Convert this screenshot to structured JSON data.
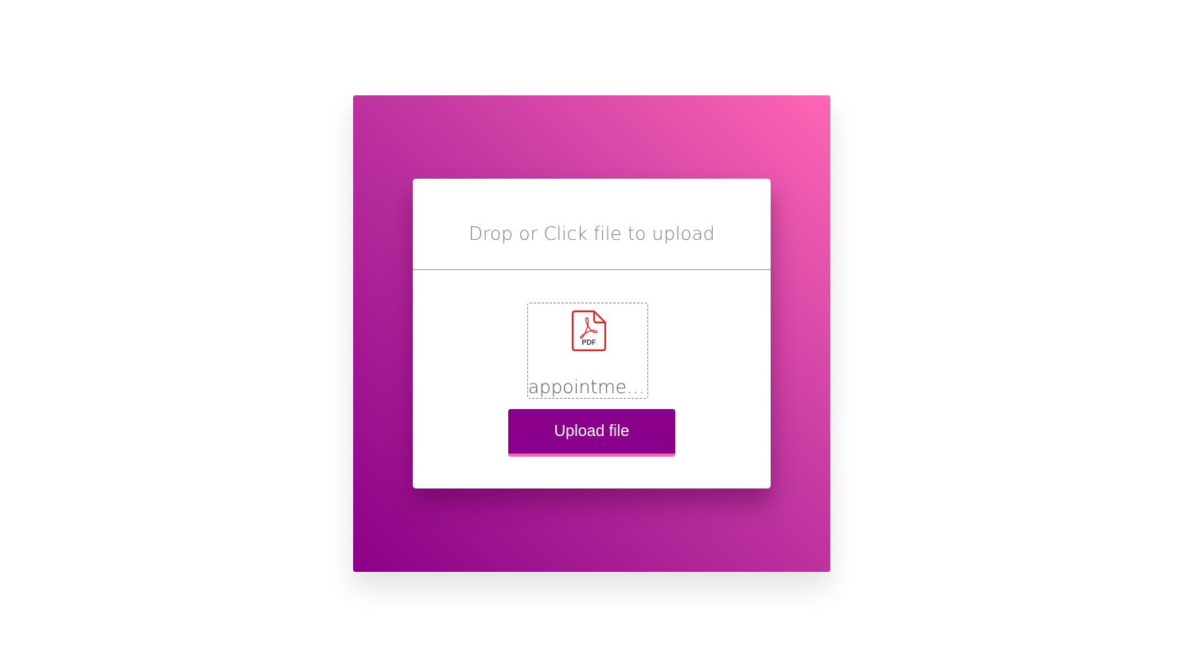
{
  "upload": {
    "drop_prompt": "Drop or Click file to upload",
    "file": {
      "name": "appointmen...",
      "type_label": "PDF",
      "icon": "pdf-file-icon"
    },
    "button_label": "Upload file"
  },
  "colors": {
    "gradient_start": "#8b0087",
    "gradient_end": "#ff66b4",
    "button": "#8b008b",
    "button_underline": "#ff5fb2",
    "pdf_red": "#e8231f"
  }
}
